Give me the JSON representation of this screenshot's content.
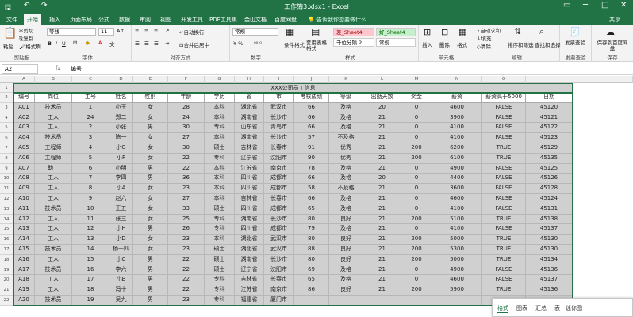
{
  "window": {
    "title": "工作簿3.xlsx1 - Excel",
    "share": "共享",
    "search_hint": "告诉我你想要做什么..."
  },
  "tabs": [
    "文件",
    "开始",
    "插入",
    "页面布局",
    "公式",
    "数据",
    "审阅",
    "视图",
    "开发工具",
    "PDF工具集",
    "金山文档",
    "百度网盘"
  ],
  "ribbon": {
    "clipboard": {
      "paste": "粘贴",
      "cut": "剪切",
      "copy": "复制",
      "format_painter": "格式刷",
      "label": "剪贴板"
    },
    "font": {
      "name": "等线",
      "size": "11",
      "label": "字体"
    },
    "align": {
      "wrap": "自动换行",
      "merge": "合并后居中",
      "label": "对齐方式"
    },
    "number": {
      "format": "常规",
      "label": "数字"
    },
    "styles": {
      "conditional": "条件格式",
      "table": "套用表格格式",
      "s1": "差_Sheet4",
      "s2": "好_Sheet4",
      "s3": "千位分隔 2",
      "s4": "常规",
      "label": "样式"
    },
    "cells": {
      "insert": "插入",
      "delete": "删除",
      "format": "格式",
      "label": "单元格"
    },
    "editing": {
      "autosum": "自动求和",
      "fill": "填充",
      "clear": "清除",
      "sort": "排序和筛选",
      "find": "查找和选择",
      "label": "编辑"
    },
    "invoice": {
      "btn": "发票查验",
      "label": "发票查验"
    },
    "save": {
      "btn": "保存到百度网盘",
      "label": "保存"
    }
  },
  "formula_bar": {
    "name_box": "A2",
    "fx": "fx",
    "value": "编号"
  },
  "columns": [
    "A",
    "B",
    "C",
    "D",
    "E",
    "F",
    "G",
    "H",
    "I",
    "J",
    "K",
    "L",
    "M",
    "N",
    "O"
  ],
  "sheet": {
    "title": "XXX公司员工信息",
    "headers": [
      "编号",
      "岗位",
      "工号",
      "姓名",
      "性别",
      "年龄",
      "学历",
      "省",
      "市",
      "考核成绩",
      "等级",
      "出勤天数",
      "奖金",
      "薪资",
      "薪资高于5000",
      "日期"
    ],
    "rows": [
      [
        "A01",
        "技术员",
        "1",
        "小王",
        "女",
        "28",
        "本科",
        "湖北省",
        "武汉市",
        "66",
        "及格",
        "20",
        "0",
        "4600",
        "FALSE",
        "45120"
      ],
      [
        "A02",
        "工人",
        "24",
        "郑二",
        "女",
        "24",
        "本科",
        "湖南省",
        "长沙市",
        "66",
        "及格",
        "21",
        "0",
        "3900",
        "FALSE",
        "45121"
      ],
      [
        "A03",
        "工人",
        "2",
        "小张",
        "男",
        "30",
        "专科",
        "山东省",
        "青岛市",
        "66",
        "及格",
        "21",
        "0",
        "4100",
        "FALSE",
        "45122"
      ],
      [
        "A04",
        "技术员",
        "3",
        "陈一",
        "女",
        "27",
        "本科",
        "湖南省",
        "长沙市",
        "57",
        "不及格",
        "21",
        "0",
        "4100",
        "FALSE",
        "45123"
      ],
      [
        "A05",
        "工程师",
        "4",
        "小G",
        "女",
        "30",
        "硕士",
        "吉林省",
        "长春市",
        "91",
        "优秀",
        "21",
        "200",
        "6200",
        "TRUE",
        "45129"
      ],
      [
        "A06",
        "工程师",
        "5",
        "小F",
        "女",
        "22",
        "专科",
        "辽宁省",
        "沈阳市",
        "90",
        "优秀",
        "21",
        "200",
        "6100",
        "TRUE",
        "45135"
      ],
      [
        "A07",
        "助工",
        "6",
        "小明",
        "男",
        "22",
        "本科",
        "江苏省",
        "南京市",
        "78",
        "及格",
        "21",
        "0",
        "4900",
        "FALSE",
        "45125"
      ],
      [
        "A08",
        "工人",
        "7",
        "李四",
        "男",
        "36",
        "本科",
        "四川省",
        "成都市",
        "66",
        "及格",
        "20",
        "0",
        "4400",
        "FALSE",
        "45126"
      ],
      [
        "A09",
        "工人",
        "8",
        "小A",
        "女",
        "23",
        "本科",
        "四川省",
        "成都市",
        "58",
        "不及格",
        "21",
        "0",
        "3600",
        "FALSE",
        "45128"
      ],
      [
        "A10",
        "工人",
        "9",
        "赵六",
        "女",
        "27",
        "本科",
        "吉林省",
        "长春市",
        "66",
        "及格",
        "21",
        "0",
        "4600",
        "FALSE",
        "45124"
      ],
      [
        "A11",
        "技术员",
        "10",
        "王五",
        "女",
        "33",
        "硕士",
        "四川省",
        "成都市",
        "65",
        "及格",
        "21",
        "0",
        "4100",
        "FALSE",
        "45131"
      ],
      [
        "A12",
        "工人",
        "11",
        "张三",
        "女",
        "25",
        "专科",
        "湖南省",
        "长沙市",
        "80",
        "良好",
        "21",
        "200",
        "5100",
        "TRUE",
        "45138"
      ],
      [
        "A13",
        "工人",
        "12",
        "小H",
        "男",
        "26",
        "专科",
        "四川省",
        "成都市",
        "79",
        "及格",
        "21",
        "0",
        "4100",
        "FALSE",
        "45137"
      ],
      [
        "A14",
        "工人",
        "13",
        "小D",
        "女",
        "23",
        "本科",
        "湖北省",
        "武汉市",
        "80",
        "良好",
        "21",
        "200",
        "5000",
        "TRUE",
        "45130"
      ],
      [
        "A15",
        "技术员",
        "14",
        "杨十四",
        "女",
        "23",
        "硕士",
        "湖北省",
        "武汉市",
        "88",
        "良好",
        "21",
        "200",
        "5300",
        "TRUE",
        "45130"
      ],
      [
        "A16",
        "工人",
        "15",
        "小C",
        "男",
        "22",
        "硕士",
        "湖南省",
        "长沙市",
        "80",
        "良好",
        "21",
        "200",
        "5000",
        "TRUE",
        "45134"
      ],
      [
        "A17",
        "技术员",
        "16",
        "李六",
        "男",
        "22",
        "硕士",
        "辽宁省",
        "沈阳市",
        "69",
        "及格",
        "21",
        "0",
        "4900",
        "FALSE",
        "45136"
      ],
      [
        "A18",
        "工人",
        "17",
        "小B",
        "男",
        "22",
        "专科",
        "吉林省",
        "长春市",
        "65",
        "及格",
        "21",
        "0",
        "4600",
        "FALSE",
        "45137"
      ],
      [
        "A19",
        "工人",
        "18",
        "冯十",
        "男",
        "22",
        "专科",
        "江苏省",
        "南京市",
        "86",
        "良好",
        "21",
        "200",
        "5900",
        "TRUE",
        "45136"
      ],
      [
        "A20",
        "技术员",
        "19",
        "吴九",
        "男",
        "23",
        "专科",
        "福建省",
        "厦门市",
        "",
        "",
        "",
        "",
        "",
        "",
        ""
      ]
    ]
  },
  "quick_analysis": {
    "tabs": [
      "格式",
      "图表",
      "汇总",
      "表",
      "迷你图"
    ]
  },
  "colors": {
    "accent": "#217346",
    "selection": "#d0d0d0"
  }
}
